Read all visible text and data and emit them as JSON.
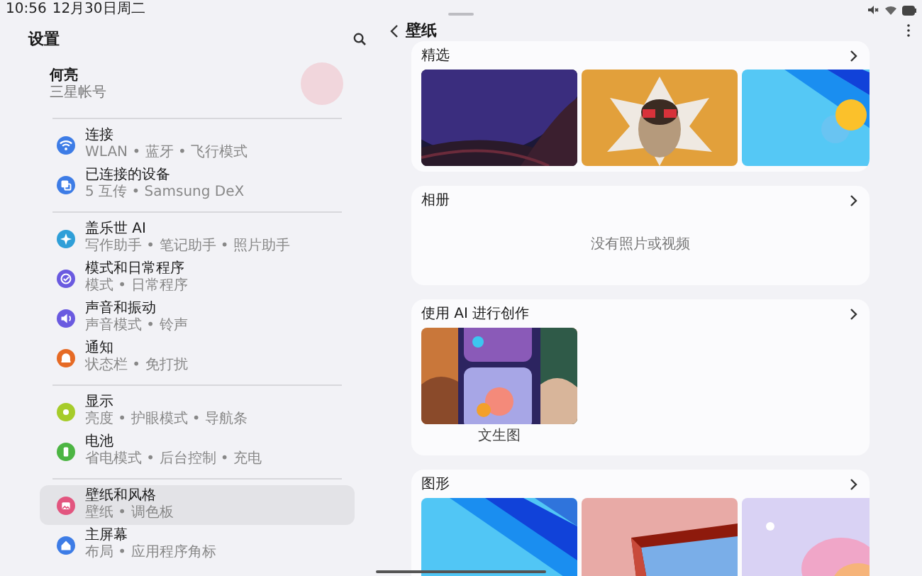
{
  "status_bar": {
    "time": "10:56",
    "date": "12月30日周二"
  },
  "settings": {
    "title": "设置",
    "profile": {
      "name": "何亮",
      "subtitle": "三星帐号"
    },
    "groups": [
      [
        {
          "title": "连接",
          "subtitle": "WLAN • 蓝牙 • 飞行模式",
          "color": "#3d7ce6",
          "selected": false
        },
        {
          "title": "已连接的设备",
          "subtitle": "5 互传 • Samsung DeX",
          "color": "#3d7ce6",
          "selected": false
        }
      ],
      [
        {
          "title": "盖乐世 AI",
          "subtitle": "写作助手 • 笔记助手 • 照片助手",
          "color": "#2f9fd8",
          "selected": false
        },
        {
          "title": "模式和日常程序",
          "subtitle": "模式 • 日常程序",
          "color": "#6a5ae0",
          "selected": false
        },
        {
          "title": "声音和振动",
          "subtitle": "声音模式 • 铃声",
          "color": "#6a5ae0",
          "selected": false
        },
        {
          "title": "通知",
          "subtitle": "状态栏 • 免打扰",
          "color": "#e66a24",
          "selected": false
        }
      ],
      [
        {
          "title": "显示",
          "subtitle": "亮度 • 护眼模式 • 导航条",
          "color": "#a6cc2a",
          "selected": false
        },
        {
          "title": "电池",
          "subtitle": "省电模式 • 后台控制 • 充电",
          "color": "#4cb543",
          "selected": false
        }
      ],
      [
        {
          "title": "壁纸和风格",
          "subtitle": "壁纸 • 调色板",
          "color": "#e2557f",
          "selected": true
        },
        {
          "title": "主屏幕",
          "subtitle": "布局 • 应用程序角标",
          "color": "#3d7ce6",
          "selected": false
        }
      ]
    ]
  },
  "wallpaper": {
    "title": "壁纸",
    "sections": [
      {
        "kind": "gallery",
        "title": "精选"
      },
      {
        "kind": "empty",
        "title": "相册",
        "message": "没有照片或视频"
      },
      {
        "kind": "tiles",
        "title": "使用 AI 进行创作",
        "tiles": [
          {
            "caption": "文生图"
          }
        ]
      },
      {
        "kind": "gallery",
        "title": "图形"
      }
    ]
  }
}
